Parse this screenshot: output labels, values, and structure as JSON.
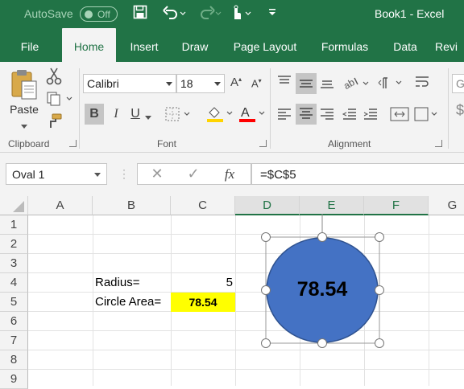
{
  "titlebar": {
    "autosave_label": "AutoSave",
    "autosave_state": "Off",
    "title": "Book1  -  Excel"
  },
  "tabs": [
    {
      "label": "File"
    },
    {
      "label": "Home"
    },
    {
      "label": "Insert"
    },
    {
      "label": "Draw"
    },
    {
      "label": "Page Layout"
    },
    {
      "label": "Formulas"
    },
    {
      "label": "Data"
    },
    {
      "label": "Revi"
    }
  ],
  "ribbon": {
    "clipboard": {
      "paste_label": "Paste",
      "group_label": "Clipboard"
    },
    "font": {
      "font_name": "Calibri",
      "font_size": "18",
      "bold": "B",
      "italic": "I",
      "underline": "U",
      "group_label": "Font",
      "font_color": "#ff0000",
      "fill_color": "#ffd400"
    },
    "alignment": {
      "group_label": "Alignment"
    },
    "extra_dd": "Ge"
  },
  "formula_bar": {
    "name_box": "Oval 1",
    "fx": "fx",
    "formula": "=$C$5"
  },
  "sheet": {
    "columns": [
      "A",
      "B",
      "C",
      "D",
      "E",
      "F",
      "G"
    ],
    "rows": [
      "1",
      "2",
      "3",
      "4",
      "5",
      "6",
      "7",
      "8",
      "9"
    ],
    "b4": "Radius=",
    "c4": "5",
    "b5": "Circle Area=",
    "c5": "78.54",
    "c5_fill": "#ffff00"
  },
  "shape": {
    "text": "78.54",
    "fill": "#4472c4",
    "stroke": "#2f528f"
  },
  "colors": {
    "excel_green": "#217346"
  }
}
